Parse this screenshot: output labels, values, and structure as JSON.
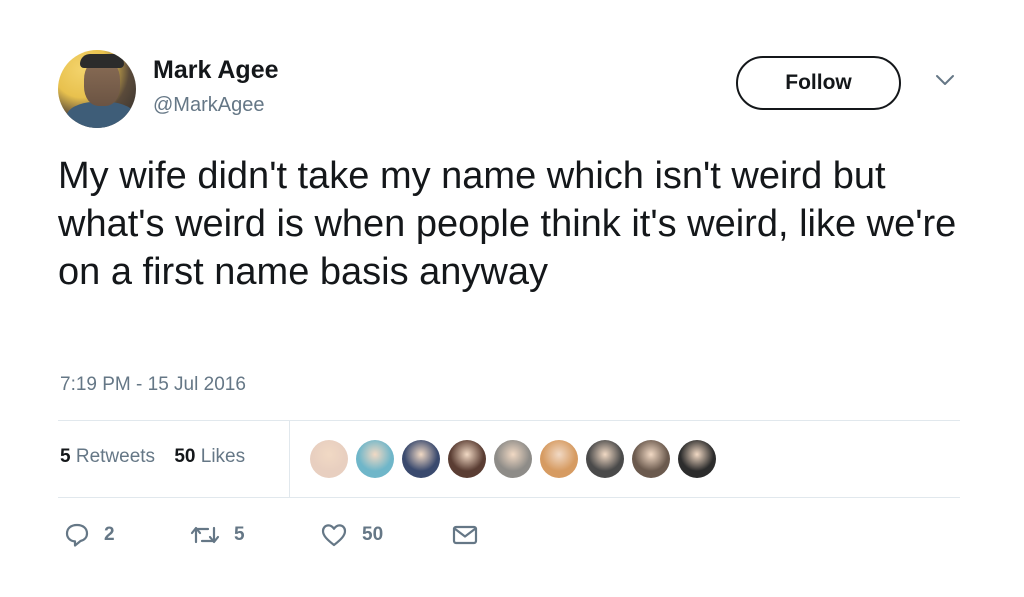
{
  "author": {
    "display_name": "Mark Agee",
    "handle": "@MarkAgee"
  },
  "follow_label": "Follow",
  "tweet": {
    "text": "My wife didn't take my name which isn't weird but what's weird is when people think it's weird, like we're on a first name basis anyway",
    "timestamp": "7:19 PM - 15 Jul 2016"
  },
  "stats": {
    "retweets_count": "5",
    "retweets_label": "Retweets",
    "likes_count": "50",
    "likes_label": "Likes"
  },
  "likers": [
    {
      "color": "#e8cfc0"
    },
    {
      "color": "#6fb6c9"
    },
    {
      "color": "#3a4a6e"
    },
    {
      "color": "#5a3d33"
    },
    {
      "color": "#8e8c88"
    },
    {
      "color": "#d69b62"
    },
    {
      "color": "#4a4a4a"
    },
    {
      "color": "#6b5a4e"
    },
    {
      "color": "#2c2c2c"
    }
  ],
  "actions": {
    "replies": "2",
    "retweets": "5",
    "likes": "50"
  },
  "icons": [
    "reply-icon",
    "retweet-icon",
    "like-icon",
    "message-icon",
    "chevron-down-icon"
  ],
  "colors": {
    "text": "#14171a",
    "secondary": "#657786",
    "divider": "#e1e8ed"
  }
}
